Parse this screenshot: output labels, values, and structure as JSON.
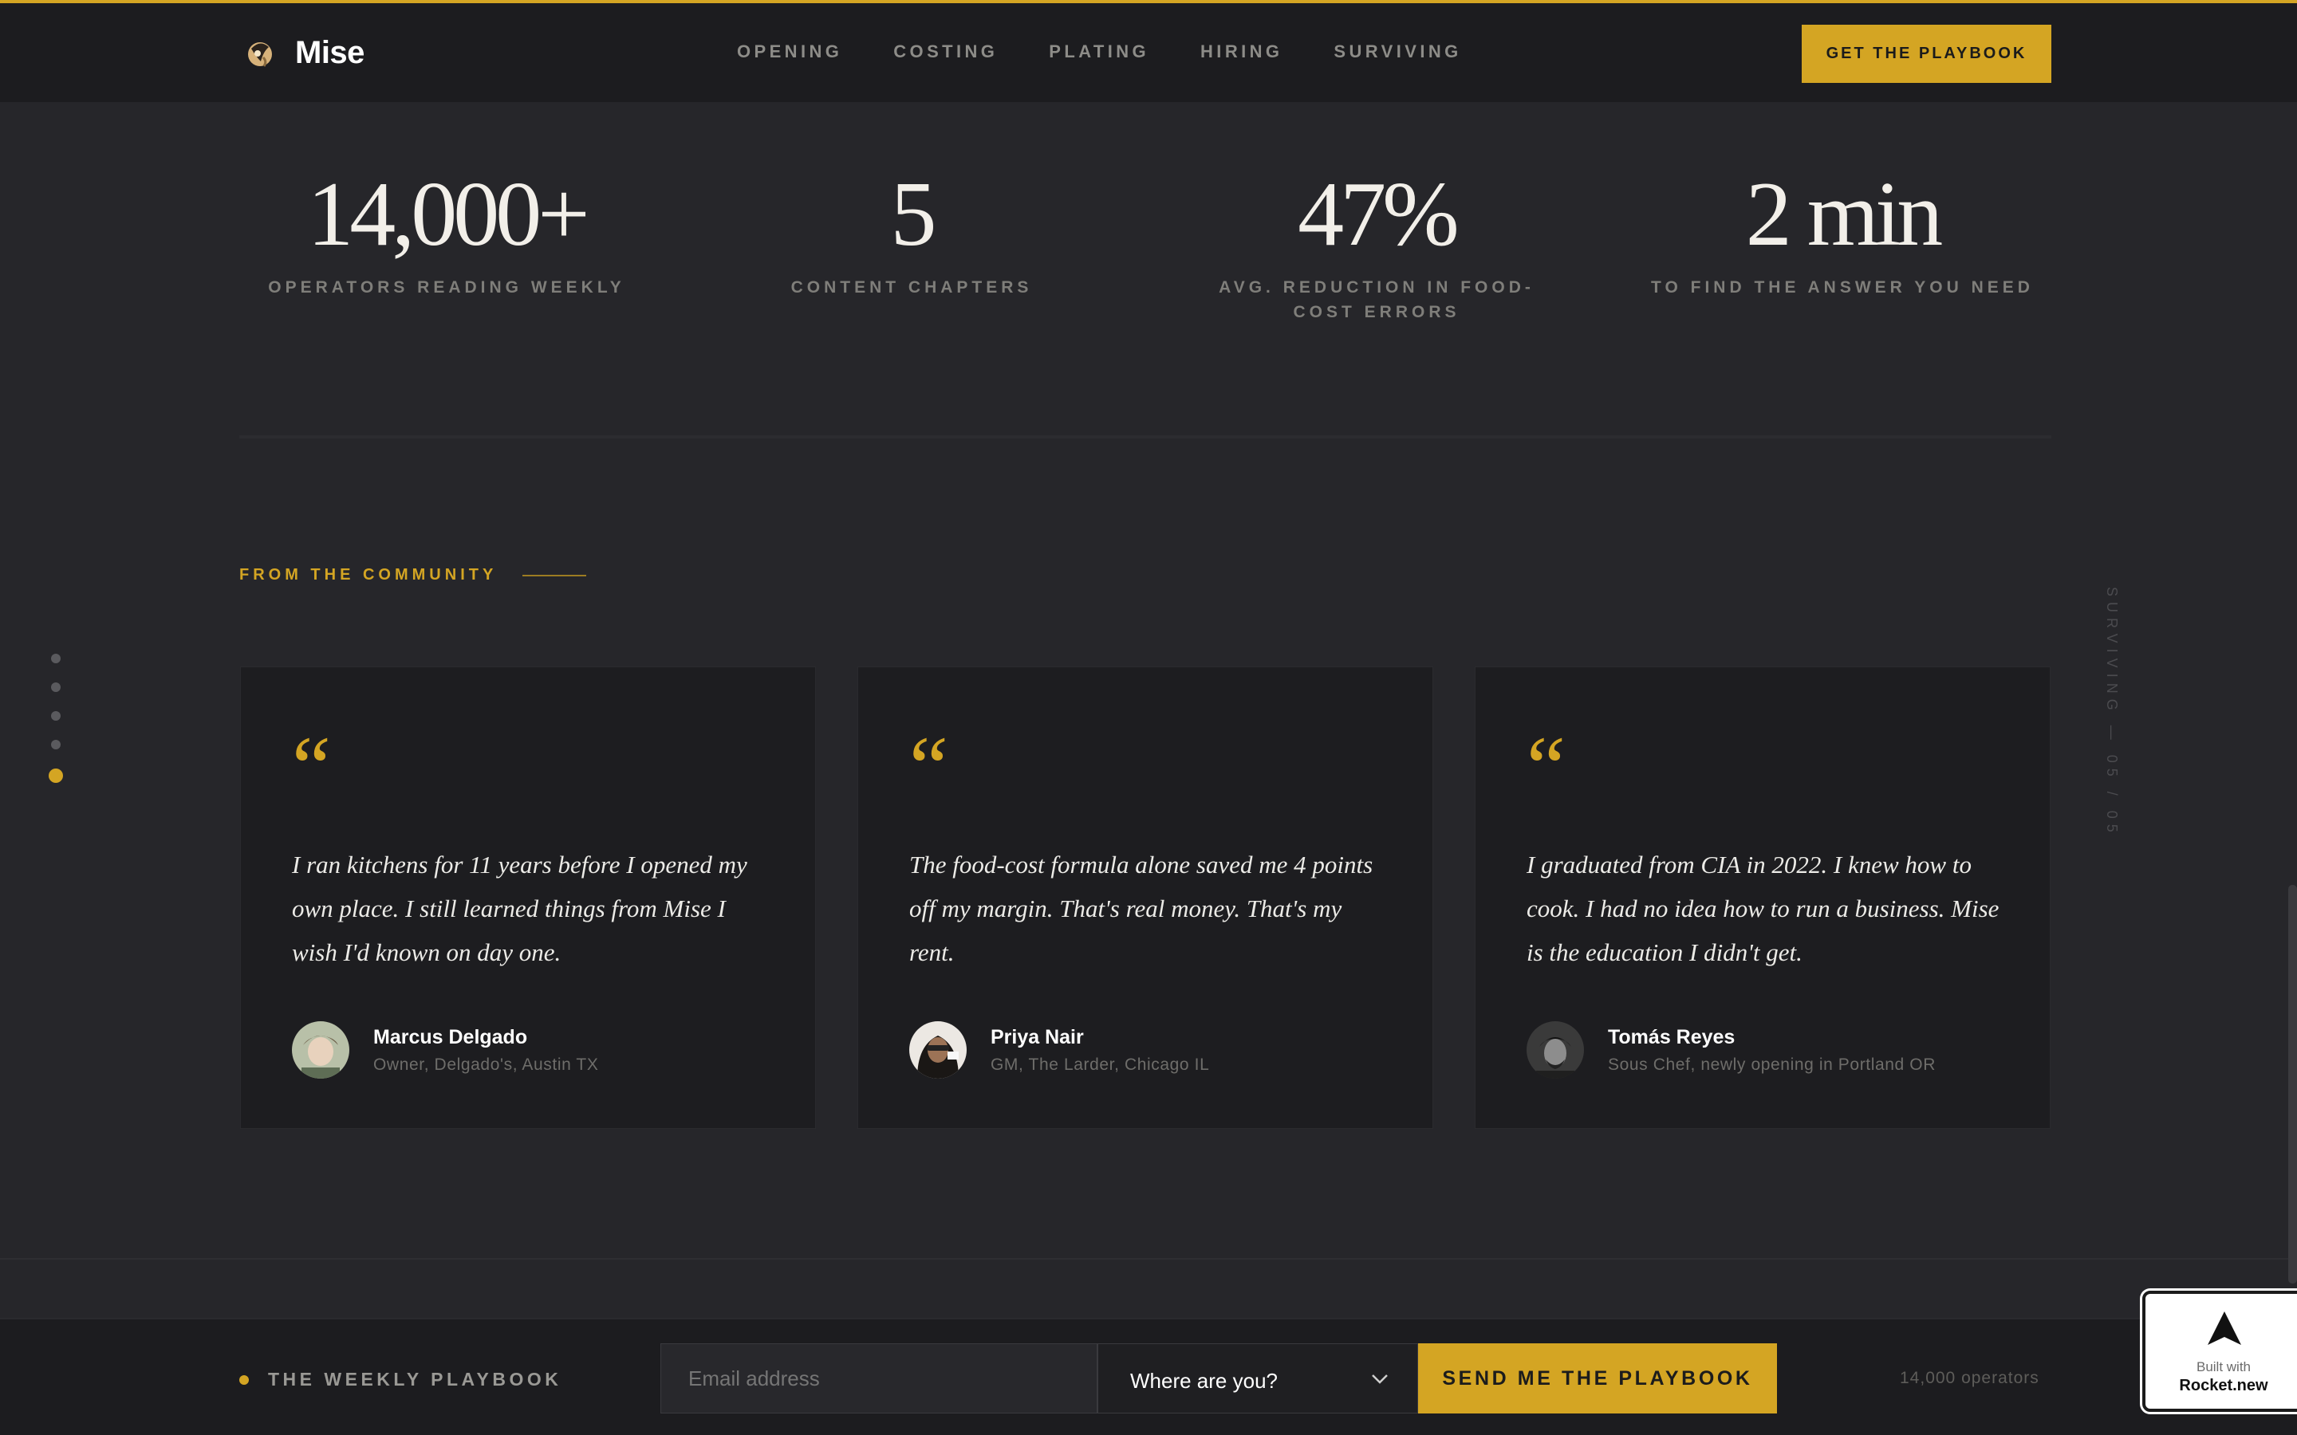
{
  "brand": {
    "name": "Mise",
    "accent": "#d4a523"
  },
  "nav": {
    "links": [
      "OPENING",
      "COSTING",
      "PLATING",
      "HIRING",
      "SURVIVING"
    ],
    "cta_label": "GET THE PLAYBOOK"
  },
  "stats": [
    {
      "value": "14,000+",
      "label": "OPERATORS READING WEEKLY"
    },
    {
      "value": "5",
      "label": "CONTENT CHAPTERS"
    },
    {
      "value": "47%",
      "label": "AVG. REDUCTION IN FOOD-COST ERRORS"
    },
    {
      "value": "2 min",
      "label": "TO FIND THE ANSWER YOU NEED"
    }
  ],
  "community": {
    "eyebrow": "FROM THE COMMUNITY",
    "section_indicator": "SURVIVING — 05 / 05",
    "section_count": 5,
    "active_section": 5,
    "testimonials": [
      {
        "quote_mark": "“",
        "quote": "I ran kitchens for 11 years before I opened my own place. I still learned things from Mise I wish I'd known on day one.",
        "name": "Marcus Delgado",
        "role": "Owner, Delgado's, Austin TX"
      },
      {
        "quote_mark": "“",
        "quote": "The food-cost formula alone saved me 4 points off my margin. That's real money. That's my rent.",
        "name": "Priya Nair",
        "role": "GM, The Larder, Chicago IL"
      },
      {
        "quote_mark": "“",
        "quote": "I graduated from CIA in 2022. I knew how to cook. I had no idea how to run a business. Mise is the education I didn't get.",
        "name": "Tomás Reyes",
        "role": "Sous Chef, newly opening in Portland OR"
      }
    ]
  },
  "signup": {
    "label": "THE WEEKLY PLAYBOOK",
    "email_placeholder": "Email address",
    "select_value": "Where are you?",
    "submit_label": "SEND ME THE PLAYBOOK",
    "count": "14,000 operators"
  },
  "badge": {
    "small": "Built with",
    "big": "Rocket.new"
  }
}
